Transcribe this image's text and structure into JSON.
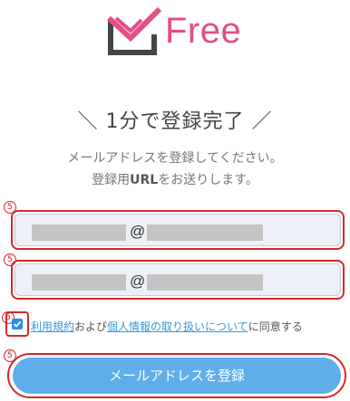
{
  "brand": {
    "name": "Free",
    "color": "#e64d86"
  },
  "heading": "＼ 1分で登録完了 ／",
  "subtitle": {
    "line1": "メールアドレスを登録してください。",
    "line2_pre": "登録用",
    "line2_bold": "URL",
    "line2_post": "をお送りします。"
  },
  "marker_label": "5",
  "email_field": {
    "at": "@"
  },
  "confirm_field": {
    "at": "@"
  },
  "agreement": {
    "checked": true,
    "link1": "利用規約",
    "mid": "および",
    "link2": "個人情報の取り扱いについて",
    "tail": "に同意する"
  },
  "submit_label": "メールアドレスを登録",
  "colors": {
    "annotation": "#d42a2a",
    "button": "#5faee9",
    "link": "#3399dd",
    "checkbox": "#2d8fe8"
  }
}
